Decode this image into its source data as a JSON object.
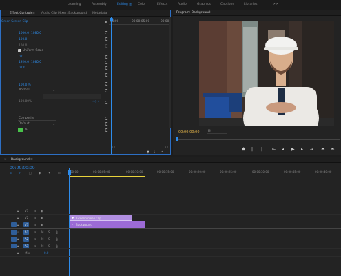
{
  "workspaces": {
    "items": [
      "Learning",
      "Assembly",
      "Editing",
      "Color",
      "Effects",
      "Audio",
      "Graphics",
      "Captions",
      "Libraries"
    ],
    "active": "Editing",
    "more": ">>"
  },
  "effect_controls": {
    "tabs": [
      "Effect Controls",
      "Audio Clip Mixer: Background",
      "Metadata"
    ],
    "clip_name": "Green Screen Clip",
    "mini_ruler": [
      "00:00",
      "00:00:05:00",
      "00:00"
    ],
    "position": [
      "1000.0",
      "1080.0"
    ],
    "scale": "100.0",
    "scale_width": "100.0",
    "uniform_scale_label": "Uniform Scale",
    "rotation": "0.0",
    "anchor": [
      "1920.0",
      "1080.0"
    ],
    "anti_flicker": "0.00",
    "opacity": "100.0 %",
    "blend_mode": "Normal",
    "speed": "100.00%",
    "composite": "Composite",
    "default": "Default"
  },
  "program_monitor": {
    "title": "Program: Background",
    "timecode": "00:00:00:00",
    "fit": "Fit",
    "colors": {
      "timecode": "#e8b84b",
      "accent": "#2d8ceb"
    }
  },
  "timeline": {
    "tab": "Background",
    "timecode": "00:00:00:00",
    "ruler": [
      "00:00",
      "00:00:05:00",
      "00:00:10:00",
      "00:00:15:00",
      "00:00:20:00",
      "00:00:25:00",
      "00:00:30:00",
      "00:00:35:00",
      "00:00:40:00"
    ],
    "video_tracks": [
      "V3",
      "V2",
      "V1"
    ],
    "audio_tracks": [
      "A1",
      "A2",
      "A3"
    ],
    "mix_label": "Mix",
    "mix_value": "0.0",
    "clips": [
      {
        "name": "Green Screen Clip",
        "track": "V2",
        "color": "#b08ee0"
      },
      {
        "name": "Background",
        "track": "V1",
        "color": "#9c6bd6"
      }
    ]
  }
}
